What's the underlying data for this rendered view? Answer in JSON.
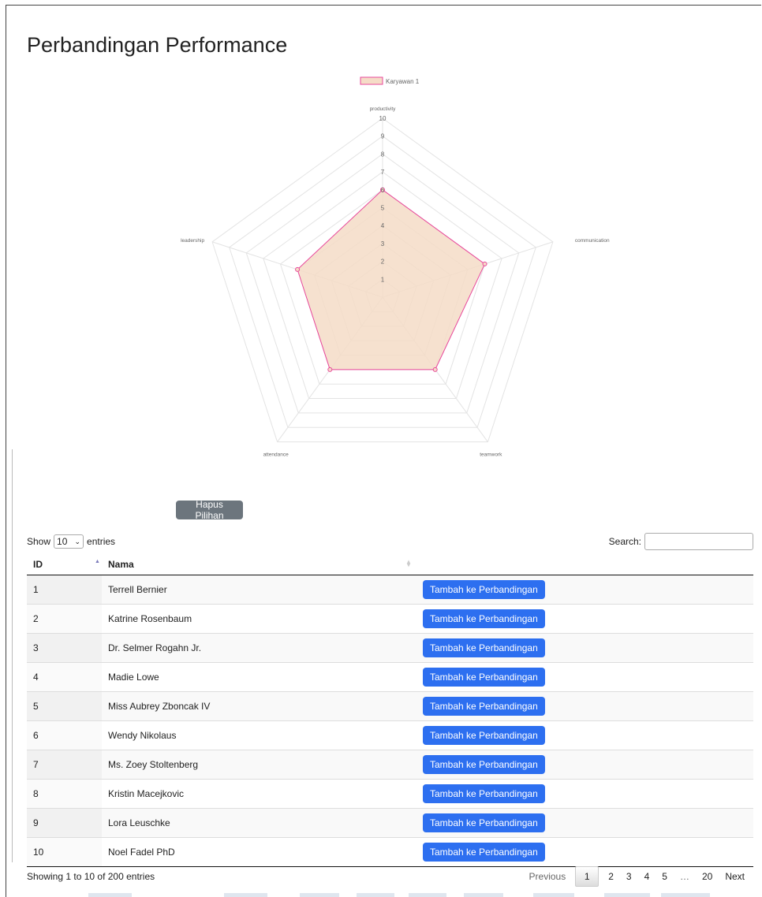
{
  "page": {
    "title": "Perbandingan Performance"
  },
  "chart_data": {
    "type": "radar",
    "labels": [
      "productivity",
      "communication",
      "teamwork",
      "attendance",
      "leadership"
    ],
    "series": [
      {
        "name": "Karyawan 1",
        "values": [
          6,
          6,
          5,
          5,
          5
        ],
        "color": "#e8479b",
        "fill": "#f5dcc7"
      }
    ],
    "rlim": [
      0,
      10
    ],
    "ticks": [
      "1",
      "2",
      "3",
      "4",
      "5",
      "6",
      "7",
      "8",
      "9",
      "10"
    ],
    "legend": "top"
  },
  "actions": {
    "clear_label": "Hapus Pilihan"
  },
  "table": {
    "show_label": "Show",
    "entries_label": "entries",
    "page_length": "10",
    "search_label": "Search:",
    "columns": [
      "ID",
      "Nama",
      ""
    ],
    "rows": [
      {
        "id": "1",
        "name": "Terrell Bernier",
        "action": "Tambah ke Perbandingan"
      },
      {
        "id": "2",
        "name": "Katrine Rosenbaum",
        "action": "Tambah ke Perbandingan"
      },
      {
        "id": "3",
        "name": "Dr. Selmer Rogahn Jr.",
        "action": "Tambah ke Perbandingan"
      },
      {
        "id": "4",
        "name": "Madie Lowe",
        "action": "Tambah ke Perbandingan"
      },
      {
        "id": "5",
        "name": "Miss Aubrey Zboncak IV",
        "action": "Tambah ke Perbandingan"
      },
      {
        "id": "6",
        "name": "Wendy Nikolaus",
        "action": "Tambah ke Perbandingan"
      },
      {
        "id": "7",
        "name": "Ms. Zoey Stoltenberg",
        "action": "Tambah ke Perbandingan"
      },
      {
        "id": "8",
        "name": "Kristin Macejkovic",
        "action": "Tambah ke Perbandingan"
      },
      {
        "id": "9",
        "name": "Lora Leuschke",
        "action": "Tambah ke Perbandingan"
      },
      {
        "id": "10",
        "name": "Noel Fadel PhD",
        "action": "Tambah ke Perbandingan"
      }
    ],
    "info": "Showing 1 to 10 of 200 entries"
  },
  "pagination": {
    "previous": "Previous",
    "pages": [
      "1",
      "2",
      "3",
      "4",
      "5",
      "…",
      "20"
    ],
    "current": "1",
    "next": "Next"
  }
}
